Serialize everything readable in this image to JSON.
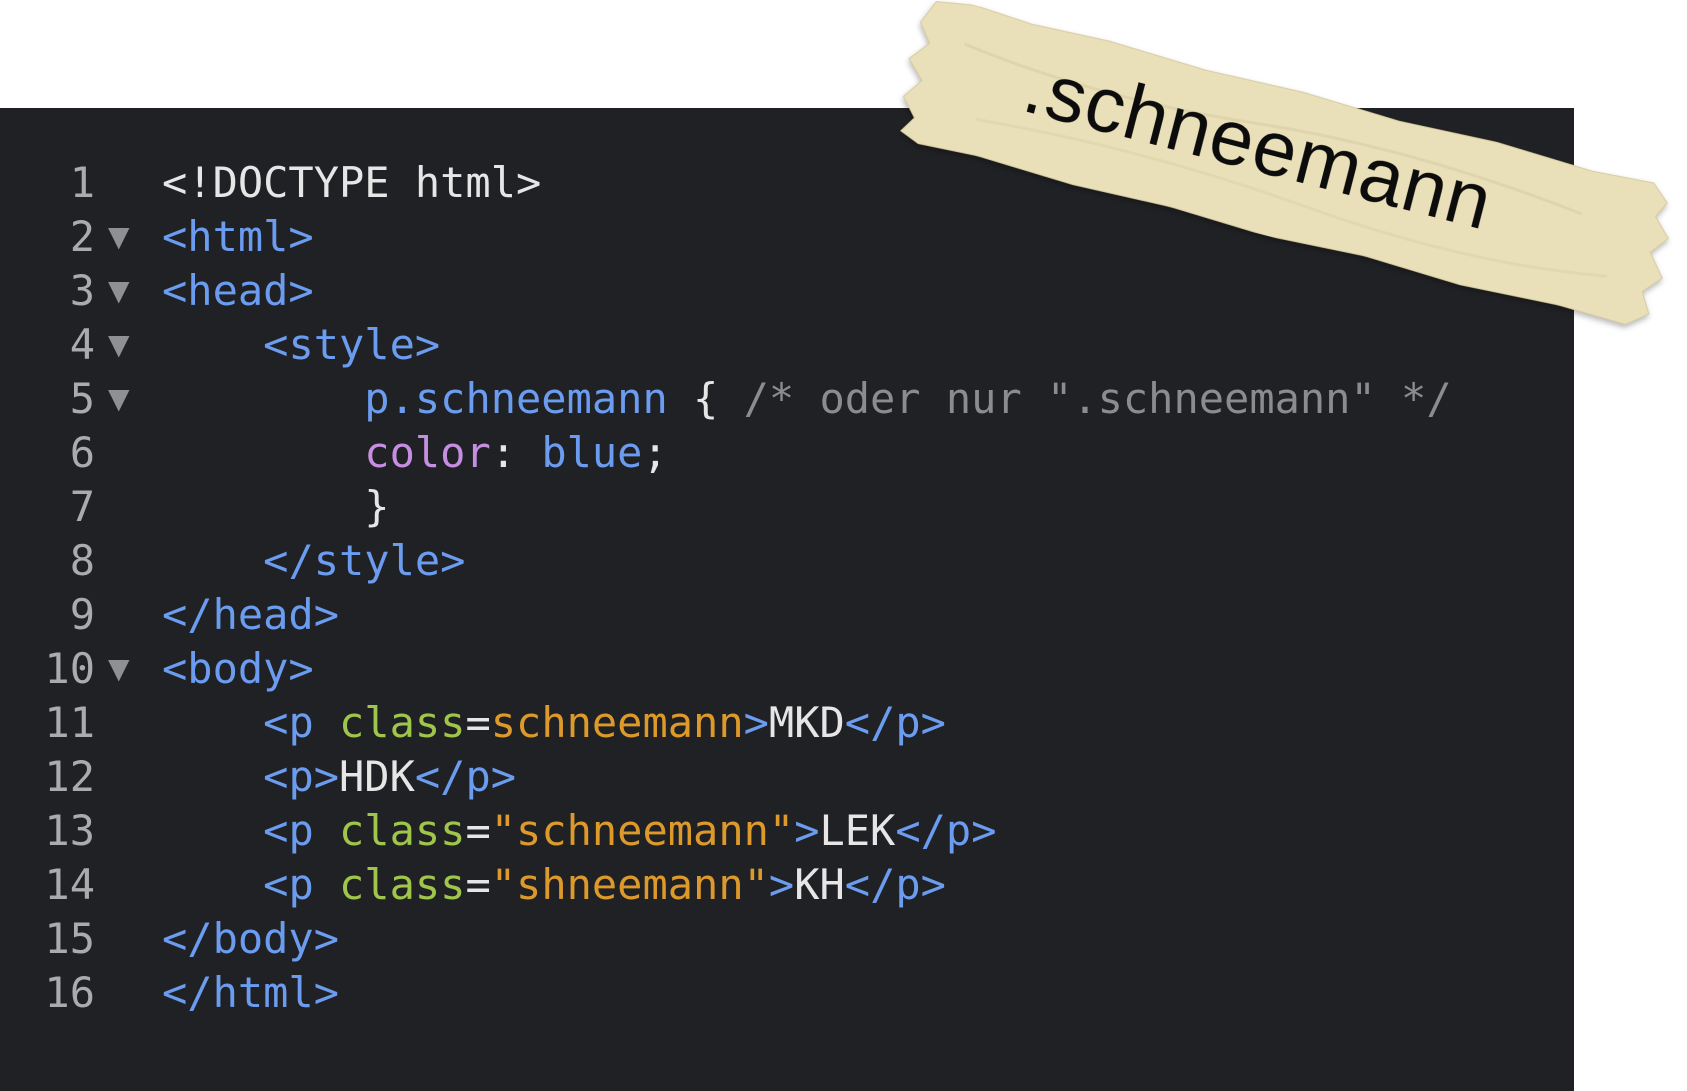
{
  "tape_label": ".schneemann",
  "colors": {
    "editor_background": "#202124",
    "line_number": "#a9abaf",
    "tag": "#6b9cf0",
    "attribute": "#9fc54a",
    "string": "#dd9a2a",
    "property": "#c58ee0",
    "comment": "#8a8c90",
    "plain": "#e6e6e6",
    "tape": "#e9dfb9"
  },
  "lines": [
    {
      "number": "1",
      "fold": false,
      "indent": "",
      "tokens": [
        {
          "t": "plain",
          "v": "<!DOCTYPE html>"
        }
      ]
    },
    {
      "number": "2",
      "fold": true,
      "indent": "",
      "tokens": [
        {
          "t": "tag",
          "v": "<html>"
        }
      ]
    },
    {
      "number": "3",
      "fold": true,
      "indent": "",
      "tokens": [
        {
          "t": "tag",
          "v": "<head>"
        }
      ]
    },
    {
      "number": "4",
      "fold": true,
      "indent": "    ",
      "tokens": [
        {
          "t": "tag",
          "v": "<style>"
        }
      ]
    },
    {
      "number": "5",
      "fold": true,
      "indent": "        ",
      "tokens": [
        {
          "t": "tag",
          "v": "p.schneemann"
        },
        {
          "t": "plain",
          "v": " { "
        },
        {
          "t": "cmt",
          "v": "/* oder nur \".schneemann\" */"
        }
      ]
    },
    {
      "number": "6",
      "fold": false,
      "indent": "        ",
      "tokens": [
        {
          "t": "prop",
          "v": "color"
        },
        {
          "t": "plain",
          "v": ": "
        },
        {
          "t": "kw",
          "v": "blue"
        },
        {
          "t": "plain",
          "v": ";"
        }
      ]
    },
    {
      "number": "7",
      "fold": false,
      "indent": "        ",
      "tokens": [
        {
          "t": "plain",
          "v": "}"
        }
      ]
    },
    {
      "number": "8",
      "fold": false,
      "indent": "    ",
      "tokens": [
        {
          "t": "tag",
          "v": "</style>"
        }
      ]
    },
    {
      "number": "9",
      "fold": false,
      "indent": "",
      "tokens": [
        {
          "t": "tag",
          "v": "</head>"
        }
      ]
    },
    {
      "number": "10",
      "fold": true,
      "indent": "",
      "tokens": [
        {
          "t": "tag",
          "v": "<body>"
        }
      ]
    },
    {
      "number": "11",
      "fold": false,
      "indent": "    ",
      "tokens": [
        {
          "t": "tag",
          "v": "<p "
        },
        {
          "t": "attr",
          "v": "class"
        },
        {
          "t": "plain",
          "v": "="
        },
        {
          "t": "val",
          "v": "schneemann"
        },
        {
          "t": "tag",
          "v": ">"
        },
        {
          "t": "plain",
          "v": "MKD"
        },
        {
          "t": "tag",
          "v": "</p>"
        }
      ]
    },
    {
      "number": "12",
      "fold": false,
      "indent": "    ",
      "tokens": [
        {
          "t": "tag",
          "v": "<p>"
        },
        {
          "t": "plain",
          "v": "HDK"
        },
        {
          "t": "tag",
          "v": "</p>"
        }
      ]
    },
    {
      "number": "13",
      "fold": false,
      "indent": "    ",
      "tokens": [
        {
          "t": "tag",
          "v": "<p "
        },
        {
          "t": "attr",
          "v": "class"
        },
        {
          "t": "plain",
          "v": "="
        },
        {
          "t": "val",
          "v": "\"schneemann\""
        },
        {
          "t": "tag",
          "v": ">"
        },
        {
          "t": "plain",
          "v": "LEK"
        },
        {
          "t": "tag",
          "v": "</p>"
        }
      ]
    },
    {
      "number": "14",
      "fold": false,
      "indent": "    ",
      "tokens": [
        {
          "t": "tag",
          "v": "<p "
        },
        {
          "t": "attr",
          "v": "class"
        },
        {
          "t": "plain",
          "v": "="
        },
        {
          "t": "val",
          "v": "\"shneemann\""
        },
        {
          "t": "tag",
          "v": ">"
        },
        {
          "t": "plain",
          "v": "KH"
        },
        {
          "t": "tag",
          "v": "</p>"
        }
      ]
    },
    {
      "number": "15",
      "fold": false,
      "indent": "",
      "tokens": [
        {
          "t": "tag",
          "v": "</body>"
        }
      ]
    },
    {
      "number": "16",
      "fold": false,
      "indent": "",
      "tokens": [
        {
          "t": "tag",
          "v": "</html>"
        }
      ]
    }
  ]
}
